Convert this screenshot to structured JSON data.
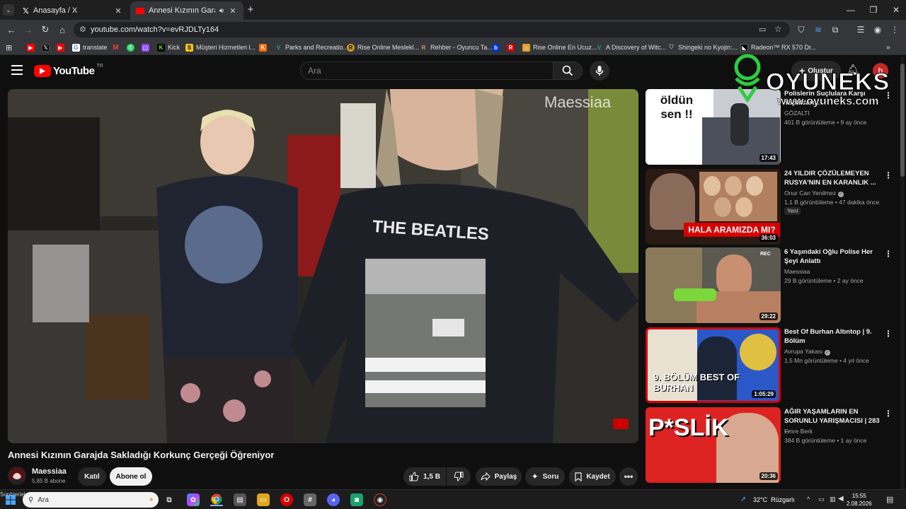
{
  "browser": {
    "tabs": [
      {
        "label": "Anasayfa / X",
        "icon": "x-logo-icon"
      },
      {
        "label": "Annesi Kızının Garajda Sakla",
        "icon": "youtube-icon",
        "active": true
      }
    ],
    "url": "youtube.com/watch?v=evRJDLTy164",
    "bookmarks": [
      {
        "label": "",
        "icon": "youtube-icon",
        "color": "#ff0000"
      },
      {
        "label": "",
        "icon": "x-logo-icon",
        "color": "#000000"
      },
      {
        "label": "",
        "icon": "youtube-icon",
        "color": "#ff0000"
      },
      {
        "label": "translate",
        "icon": "google-icon",
        "color": "#ffffff"
      },
      {
        "label": "",
        "icon": "gmail-icon",
        "color": "#ea4335"
      },
      {
        "label": "",
        "icon": "whatsapp-icon",
        "color": "#25d366"
      },
      {
        "label": "",
        "icon": "twitch-icon",
        "color": "#9146ff"
      },
      {
        "label": "Kick",
        "icon": "kick-icon",
        "color": "#53fc18"
      },
      {
        "label": "Müşteri Hizmetleri l...",
        "icon": "s-icon",
        "color": "#f5c518"
      },
      {
        "label": "",
        "icon": "k-icon",
        "color": "#ff6a00"
      },
      {
        "label": "Parks and Recreatio...",
        "icon": "v-icon",
        "color": "#1ba784"
      },
      {
        "label": "Rise Online Meslekl...",
        "icon": "r-icon",
        "color": "#d4a017"
      },
      {
        "label": "Rehber - Oyuncu Ta...",
        "icon": "r-icon",
        "color": "#c8a060"
      },
      {
        "label": "",
        "icon": "b-icon",
        "color": "#0033cc"
      },
      {
        "label": "",
        "icon": "r-icon",
        "color": "#cc0000"
      },
      {
        "label": "Rise Online En Ucuz...",
        "icon": "store-icon",
        "color": "#e0a030"
      },
      {
        "label": "A Discovery of Witc...",
        "icon": "v-icon",
        "color": "#1ba784"
      },
      {
        "label": "Shingeki no Kyojin:...",
        "icon": "shield-icon",
        "color": "#888888"
      },
      {
        "label": "Radeon™ RX 570 Dr...",
        "icon": "amd-icon",
        "color": "#000000"
      }
    ]
  },
  "youtube": {
    "logo_text": "YouTube",
    "region": "TR",
    "search_placeholder": "Ara",
    "create_label": "Oluştur",
    "avatar_letter": "h"
  },
  "video": {
    "overlay_watermark": "Maessiaa",
    "title": "Annesi Kızının Garajda Sakladığı Korkunç Gerçeği Öğreniyor",
    "channel": "Maessiaa",
    "subscribers": "5,85 B abone",
    "join_label": "Katıl",
    "subscribe_label": "Abone ol",
    "likes": "1,5 B",
    "share_label": "Paylaş",
    "ask_label": "Soru",
    "save_label": "Kaydet"
  },
  "recommendations": [
    {
      "title": "Polislerin Suçlulara Karşı Yaptıkları...",
      "channel": "GÖZALTI",
      "verified": false,
      "meta": "401 B görüntüleme • 9 ay önce",
      "duration": "17:43",
      "thumb_text": "öldün sen !!",
      "badge": ""
    },
    {
      "title": "24 YILDIR ÇÖZÜLEMEYEN RUSYA'NIN EN KARANLIK ...",
      "channel": "Onur Can Yenilmez",
      "verified": true,
      "meta": "1,1 B görüntüleme • 47 dakika önce",
      "duration": "36:03",
      "thumb_text": "HALA ARAMIZDA MI?",
      "badge": "Yeni"
    },
    {
      "title": "6 Yaşındaki Oğlu Polise Her Şeyi Anlattı",
      "channel": "Maessiaa",
      "verified": false,
      "meta": "29 B görüntüleme • 2 ay önce",
      "duration": "29:22",
      "thumb_text": "REC",
      "badge": ""
    },
    {
      "title": "Best Of Burhan Altıntop | 9. Bölüm",
      "channel": "Avrupa Yakası",
      "verified": true,
      "meta": "1,5 Mn görüntüleme • 4 yıl önce",
      "duration": "1:05:29",
      "thumb_text": "9. BÖLÜM BEST OF BURHAN",
      "badge": ""
    },
    {
      "title": "AĞIR YAŞAMLARIN EN SORUNLU YARIŞMACISI | 283 ...",
      "channel": "Emre Berk",
      "verified": false,
      "meta": "384 B görüntüleme • 1 ay önce",
      "duration": "20:36",
      "thumb_text": "P*SLİK",
      "badge": ""
    }
  ],
  "watermark": {
    "brand": "OYUNEKS",
    "site": "www.oyuneks.com"
  },
  "taskbar": {
    "search_text": "Ara",
    "weather": "32°C  Rüzgarlı",
    "time": "15:55",
    "date": "2.08.2026",
    "side_label": "Sophieriel"
  },
  "colors": {
    "accent": "#ff0000",
    "watermark_green": "#2ecc40",
    "background": "#0f0f0f"
  }
}
